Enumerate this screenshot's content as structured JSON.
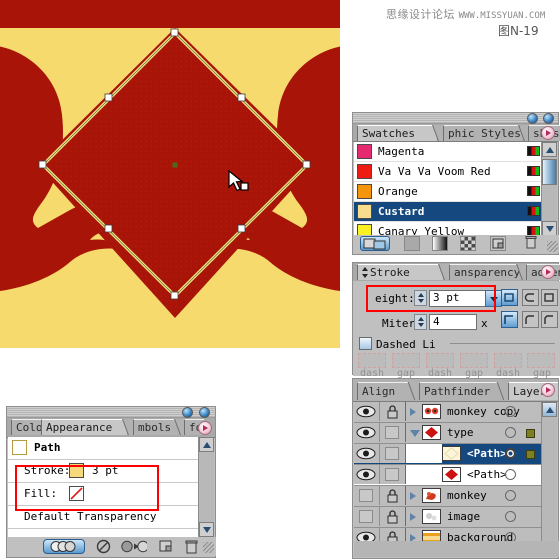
{
  "watermark": {
    "cn": "思缘设计论坛",
    "en": "WWW.MISSYUAN.COM",
    "figure": "图N-19"
  },
  "canvas": {
    "name": "artboard",
    "band_color": "#a81408",
    "background_color": "#f7da6e",
    "shape_fill": "#a81408",
    "stroke_color": "#f0e68c",
    "anchor_color": "#ffffff",
    "center_point_color": "#4e6b18",
    "cursor": "arrow-cursor"
  },
  "swatches": {
    "panel_title": "Swatches",
    "tabs": [
      {
        "label": "Swatches",
        "selected": true
      },
      {
        "label": "phic Styles",
        "selected": false
      },
      {
        "label": "shes",
        "selected": false
      }
    ],
    "rows": [
      {
        "name": "Magenta",
        "color": "#e62a72",
        "selected": false
      },
      {
        "name": "Va Va Va Voom Red",
        "color": "#ef1c14",
        "selected": false
      },
      {
        "name": "Orange",
        "color": "#f5950c",
        "selected": false
      },
      {
        "name": "Custard",
        "color": "#f8dd8e",
        "selected": true
      },
      {
        "name": "Canary Yellow",
        "color": "#fbf022",
        "selected": false
      }
    ],
    "footer_buttons": [
      "swatch-libraries-button",
      "show-swatch-kinds-button",
      "gradient-swatch-button",
      "pattern-swatch-button",
      "new-swatch-button",
      "delete-swatch-button"
    ],
    "scroll_up": "▲",
    "scroll_down": "▼"
  },
  "stroke": {
    "tabs": [
      {
        "label": "Stroke",
        "selected": true
      },
      {
        "label": "ansparency",
        "selected": false
      },
      {
        "label": "adient",
        "selected": false
      }
    ],
    "weight_label": "eight:",
    "weight_value": "3 pt",
    "miter_label": "Miter",
    "miter_value": "4",
    "miter_unit": "x",
    "dashed_label": "Dashed Li",
    "dash_fields": [
      "dash",
      "gap",
      "dash",
      "gap",
      "dash",
      "gap"
    ],
    "cap_buttons": [
      "butt-cap",
      "round-cap",
      "projecting-cap"
    ],
    "join_buttons": [
      "miter-join",
      "round-join",
      "bevel-join"
    ],
    "highlight_color": "#ff0000"
  },
  "layers": {
    "tabs": [
      {
        "label": "Align",
        "selected": false
      },
      {
        "label": "Pathfinder",
        "selected": false
      },
      {
        "label": "Layers",
        "selected": true
      }
    ],
    "rows": [
      {
        "name": "monkey copy",
        "visible": true,
        "locked": true,
        "expandable": true,
        "expanded": false,
        "child": false,
        "selected": false,
        "targeted": false,
        "has_selection_square": false,
        "thumb": "monkey-eyes-thumb"
      },
      {
        "name": "type",
        "visible": true,
        "locked": false,
        "expandable": true,
        "expanded": true,
        "child": false,
        "selected": false,
        "targeted": false,
        "has_selection_square": true,
        "thumb": "red-diamond-thumb"
      },
      {
        "name": "<Path>",
        "visible": true,
        "locked": false,
        "expandable": false,
        "expanded": false,
        "child": true,
        "selected": true,
        "targeted": true,
        "has_selection_square": true,
        "thumb": "empty-path-thumb"
      },
      {
        "name": "<Path>",
        "visible": true,
        "locked": false,
        "expandable": false,
        "expanded": false,
        "child": true,
        "selected": false,
        "targeted": false,
        "has_selection_square": false,
        "thumb": "red-diamond-thumb"
      },
      {
        "name": "monkey",
        "visible": false,
        "locked": true,
        "expandable": true,
        "expanded": false,
        "child": false,
        "selected": false,
        "targeted": false,
        "has_selection_square": false,
        "thumb": "monkey-thumb"
      },
      {
        "name": "image",
        "visible": false,
        "locked": true,
        "expandable": true,
        "expanded": false,
        "child": false,
        "selected": false,
        "targeted": false,
        "has_selection_square": false,
        "thumb": "image-thumb"
      },
      {
        "name": "background",
        "visible": true,
        "locked": true,
        "expandable": true,
        "expanded": false,
        "child": false,
        "selected": false,
        "targeted": false,
        "has_selection_square": false,
        "thumb": "background-stripe-thumb"
      }
    ]
  },
  "appearance": {
    "tabs": [
      {
        "label": "Colo",
        "selected": false
      },
      {
        "label": "Appearance",
        "selected": true
      },
      {
        "label": "mbols",
        "selected": false
      },
      {
        "label": "fo",
        "selected": false
      }
    ],
    "title": "Path",
    "stroke_label": "Stroke:",
    "stroke_value": "3 pt",
    "stroke_swatch_color": "#f5d97a",
    "fill_label": "Fill:",
    "fill_value": "",
    "fill_swatch": "none-slash",
    "transparency_label": "Default Transparency",
    "footer_buttons": [
      "new-art-has-basic-appearance-button",
      "clear-appearance-button",
      "reduce-to-basic-appearance-button",
      "duplicate-item-button",
      "delete-item-button"
    ],
    "highlight_color": "#ff0000"
  }
}
